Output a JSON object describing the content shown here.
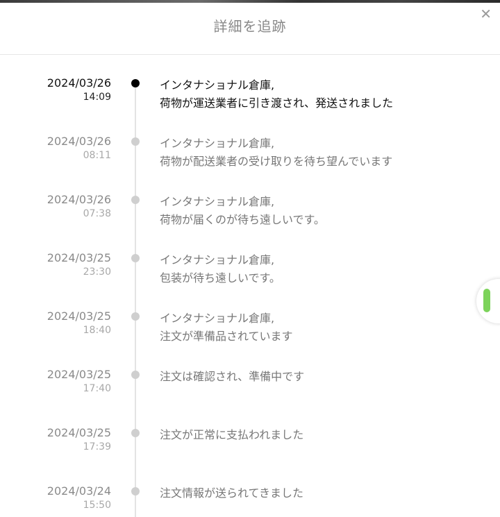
{
  "header": {
    "title": "詳細を追跡",
    "close_icon": "close-icon"
  },
  "colors": {
    "active_dot": "#000000",
    "inactive_dot": "#cfcfcf",
    "badge_accent": "#7cd35a"
  },
  "timeline": [
    {
      "date": "2024/03/26",
      "time": "14:09",
      "line1": "インタナショナル倉庫,",
      "line2": "荷物が運送業者に引き渡され、発送されました",
      "active": true
    },
    {
      "date": "2024/03/26",
      "time": "08:11",
      "line1": "インタナショナル倉庫,",
      "line2": "荷物が配送業者の受け取りを待ち望んでいます",
      "active": false
    },
    {
      "date": "2024/03/26",
      "time": "07:38",
      "line1": "インタナショナル倉庫,",
      "line2": "荷物が届くのが待ち遠しいです。",
      "active": false
    },
    {
      "date": "2024/03/25",
      "time": "23:30",
      "line1": "インタナショナル倉庫,",
      "line2": "包装が待ち遠しいです。",
      "active": false
    },
    {
      "date": "2024/03/25",
      "time": "18:40",
      "line1": "インタナショナル倉庫,",
      "line2": "注文が準備品されています",
      "active": false
    },
    {
      "date": "2024/03/25",
      "time": "17:40",
      "line1": "注文は確認され、準備中です",
      "line2": "",
      "active": false
    },
    {
      "date": "2024/03/25",
      "time": "17:39",
      "line1": "注文が正常に支払われました",
      "line2": "",
      "active": false
    },
    {
      "date": "2024/03/24",
      "time": "15:50",
      "line1": "注文情報が送られてきました",
      "line2": "",
      "active": false
    }
  ]
}
